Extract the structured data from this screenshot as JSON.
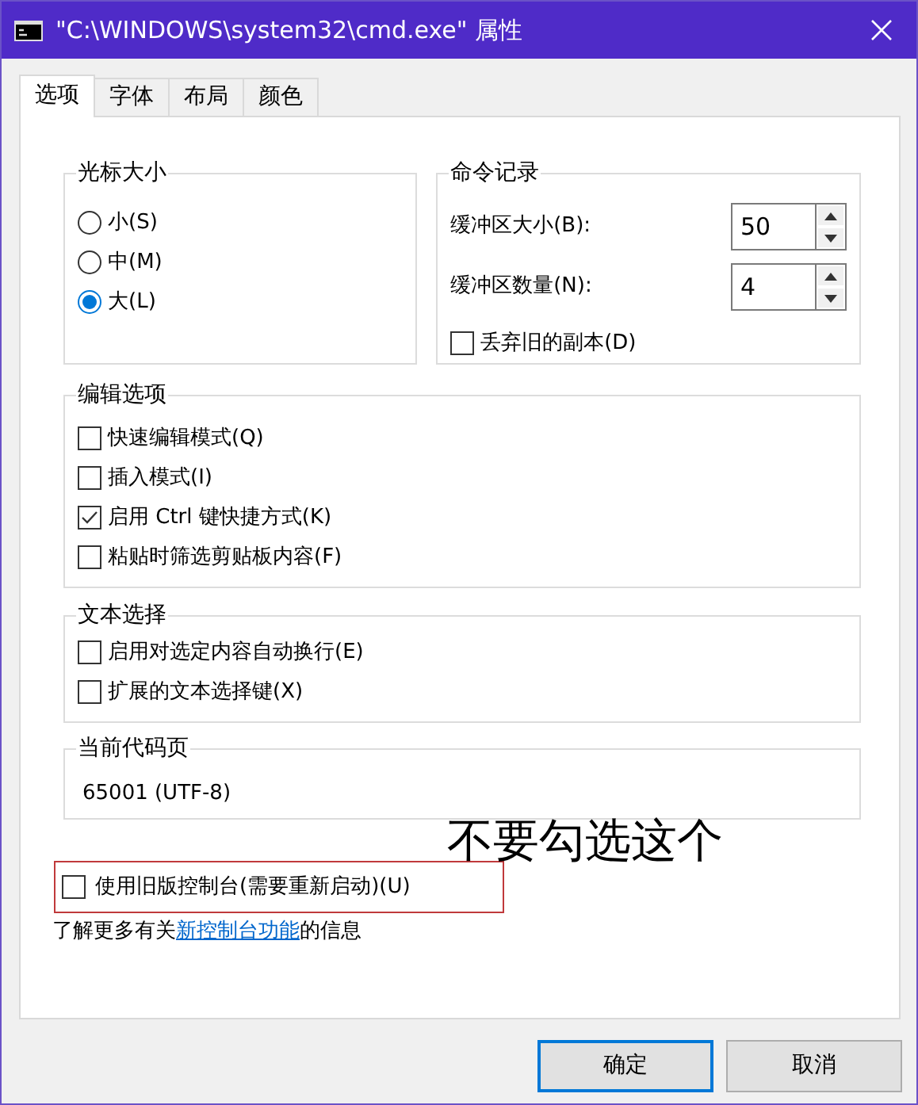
{
  "window": {
    "title": "\"C:\\WINDOWS\\system32\\cmd.exe\" 属性"
  },
  "tabs": [
    {
      "label": "选项",
      "selected": true
    },
    {
      "label": "字体",
      "selected": false
    },
    {
      "label": "布局",
      "selected": false
    },
    {
      "label": "颜色",
      "selected": false
    }
  ],
  "cursor_size": {
    "title": "光标大小",
    "options": [
      {
        "label": "小(S)",
        "selected": false
      },
      {
        "label": "中(M)",
        "selected": false
      },
      {
        "label": "大(L)",
        "selected": true
      }
    ]
  },
  "command_history": {
    "title": "命令记录",
    "fields": [
      {
        "label": "缓冲区大小(B):",
        "value": "50"
      },
      {
        "label": "缓冲区数量(N):",
        "value": "4"
      }
    ],
    "discard_old": {
      "label": "丢弃旧的副本(D)",
      "checked": false
    }
  },
  "edit_options": {
    "title": "编辑选项",
    "items": [
      {
        "label": "快速编辑模式(Q)",
        "checked": false
      },
      {
        "label": "插入模式(I)",
        "checked": false
      },
      {
        "label": "启用 Ctrl 键快捷方式(K)",
        "checked": true
      },
      {
        "label": "粘贴时筛选剪贴板内容(F)",
        "checked": false
      }
    ]
  },
  "text_selection": {
    "title": "文本选择",
    "items": [
      {
        "label": "启用对选定内容自动换行(E)",
        "checked": false
      },
      {
        "label": "扩展的文本选择键(X)",
        "checked": false
      }
    ]
  },
  "code_page": {
    "title": "当前代码页",
    "value": "65001 (UTF-8)"
  },
  "annotation": {
    "text": "不要勾选这个"
  },
  "legacy_console": {
    "label": "使用旧版控制台(需要重新启动)(U)",
    "checked": false,
    "highlighted": true
  },
  "learn_more": {
    "before": "了解更多有关",
    "link": "新控制台功能",
    "after": "的信息"
  },
  "buttons": [
    {
      "label": "确定",
      "kind": "default"
    },
    {
      "label": "取消",
      "kind": "normal"
    }
  ]
}
